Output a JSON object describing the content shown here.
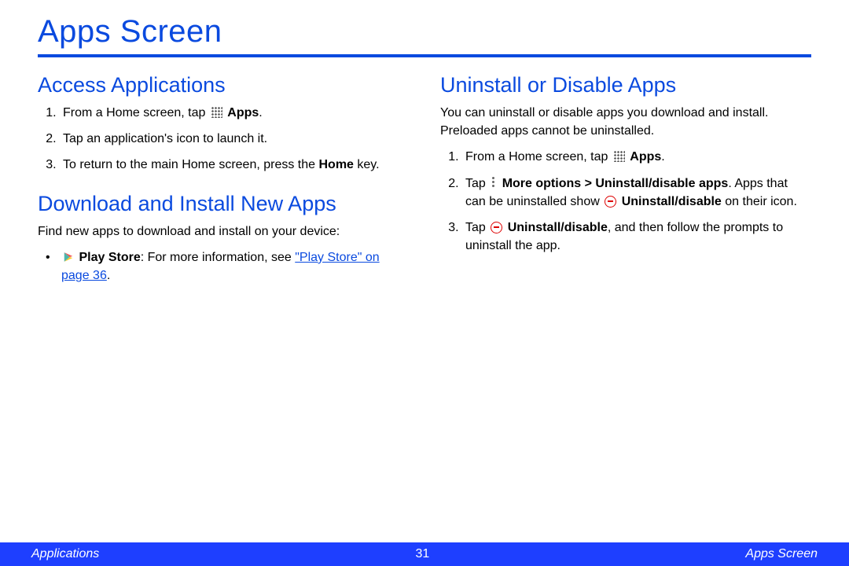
{
  "page_title": "Apps Screen",
  "left": {
    "section1_title": "Access Applications",
    "s1_li1_a": "From a Home screen, tap ",
    "s1_li1_b": "Apps",
    "s1_li1_c": ".",
    "s1_li2": "Tap an application's icon to launch it.",
    "s1_li3_a": "To return to the main Home screen, press the ",
    "s1_li3_b": "Home",
    "s1_li3_c": " key.",
    "section2_title": "Download and Install New Apps",
    "s2_intro": "Find new apps to download and install on your device:",
    "s2_li1_a": "Play Store",
    "s2_li1_b": ": For more information, see ",
    "s2_li1_link": "\"Play Store\" on page 36",
    "s2_li1_c": "."
  },
  "right": {
    "section_title": "Uninstall or Disable Apps",
    "intro": "You can uninstall or disable apps you download and install. Preloaded apps cannot be uninstalled.",
    "li1_a": "From a Home screen, tap ",
    "li1_b": "Apps",
    "li1_c": ".",
    "li2_a": "Tap ",
    "li2_b": "More options > Uninstall/disable apps",
    "li2_c": ". Apps that can be uninstalled show ",
    "li2_d": "Uninstall/disable",
    "li2_e": " on their icon.",
    "li3_a": "Tap ",
    "li3_b": "Uninstall/disable",
    "li3_c": ", and then follow the prompts to uninstall the app."
  },
  "footer": {
    "left": "Applications",
    "center": "31",
    "right": "Apps Screen"
  }
}
